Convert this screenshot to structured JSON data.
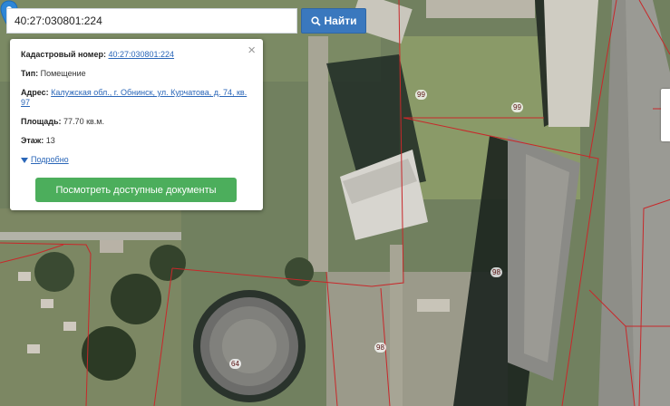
{
  "search": {
    "value": "40:27:030801:224",
    "button_label": "Найти",
    "icon": "search-icon"
  },
  "popup": {
    "cadastral_label": "Кадастровый номер:",
    "cadastral_value": "40:27:030801:224",
    "type_label": "Тип:",
    "type_value": "Помещение",
    "address_label": "Адрес:",
    "address_value": "Калужская обл., г. Обнинск, ул. Курчатова, д. 74, кв. 97",
    "area_label": "Площадь:",
    "area_value": "77.70 кв.м.",
    "floor_label": "Этаж:",
    "floor_value": "13",
    "more_label": "Подробно",
    "docs_button": "Посмотреть доступные документы"
  },
  "map": {
    "parcel_labels": [
      "99",
      "99",
      "98",
      "98",
      "64"
    ],
    "colors": {
      "boundary": "#c8282a",
      "accent_blue": "#3a78be",
      "marker": "#2e86d6",
      "docs_button": "#4cae5c"
    }
  }
}
